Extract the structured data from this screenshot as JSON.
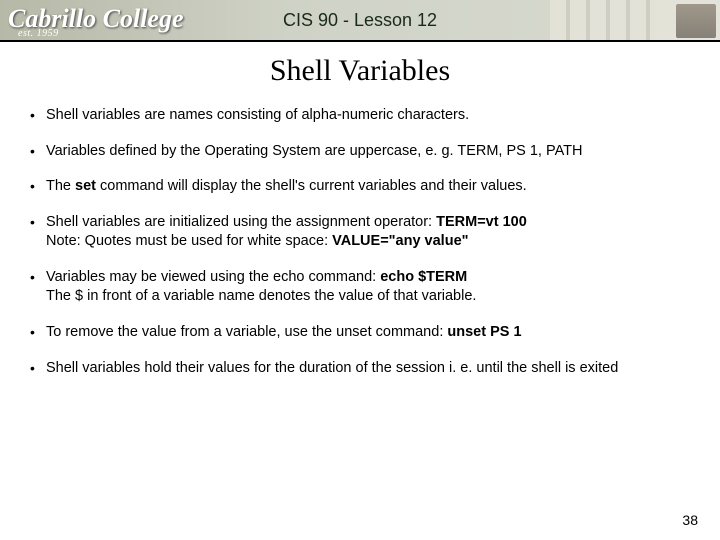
{
  "header": {
    "logo_text": "Cabrillo College",
    "est": "est. 1959",
    "course_line": "CIS 90 - Lesson 12"
  },
  "title": "Shell Variables",
  "bullets": {
    "b1": "Shell variables are names consisting of alpha-numeric characters.",
    "b2": "Variables defined by the Operating System are uppercase, e. g. TERM, PS 1, PATH",
    "b3_pre": "The ",
    "b3_cmd": "set",
    "b3_post": " command will display the shell's current variables and their values.",
    "b4_line1_pre": "Shell variables are initialized using the assignment operator: ",
    "b4_line1_bold": "TERM=vt 100",
    "b4_line2_pre": "Note: Quotes must be used for white space: ",
    "b4_line2_bold": "VALUE=\"any value\"",
    "b5_line1_pre": "Variables may be viewed using the echo command: ",
    "b5_line1_bold": "echo $TERM",
    "b5_line2": "The $ in front of a variable name denotes the value of that variable.",
    "b6_pre": "To remove the value from a variable, use the unset command: ",
    "b6_bold": "unset PS 1",
    "b7": "Shell variables hold their values for the duration of the session i. e. until the shell is exited"
  },
  "page_number": "38"
}
